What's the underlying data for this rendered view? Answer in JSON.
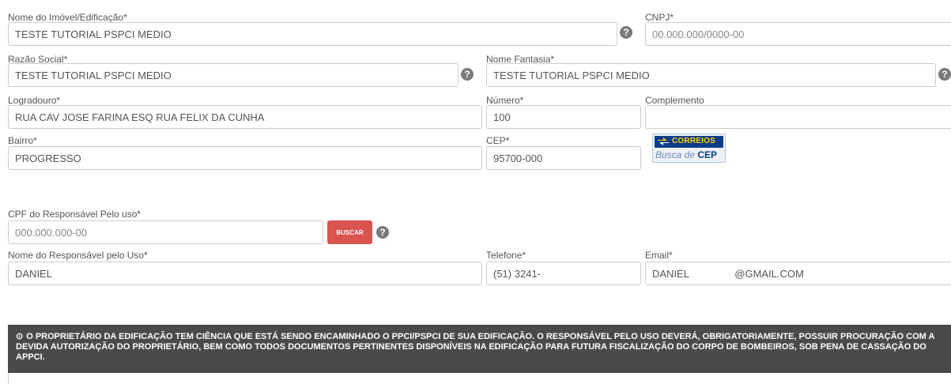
{
  "fields": {
    "nome_imovel": {
      "label": "Nome do Imóvel/Edificação*",
      "value": "TESTE TUTORIAL PSPCI MEDIO"
    },
    "cnpj": {
      "label": "CNPJ*",
      "placeholder": "00.000.000/0000-00"
    },
    "razao_social": {
      "label": "Razão Social*",
      "value": "TESTE TUTORIAL PSPCI MEDIO"
    },
    "nome_fantasia": {
      "label": "Nome Fantasia*",
      "value": "TESTE TUTORIAL PSPCI MEDIO"
    },
    "logradouro": {
      "label": "Logradouro*",
      "value": "RUA CAV JOSE FARINA ESQ RUA FELIX DA CUNHA"
    },
    "numero": {
      "label": "Número*",
      "value": "100"
    },
    "complemento": {
      "label": "Complemento",
      "value": ""
    },
    "bairro": {
      "label": "Bairro*",
      "value": "PROGRESSO"
    },
    "cep": {
      "label": "CEP*",
      "value": "95700-000"
    },
    "cpf_responsavel": {
      "label": "CPF do Responsável Pelo uso*",
      "placeholder": "000.000.000-00"
    },
    "nome_responsavel": {
      "label": "Nome do Responsável pelo Uso*",
      "value": "DANIEL"
    },
    "telefone": {
      "label": "Telefone*",
      "value": "(51) 3241-"
    },
    "email": {
      "label": "Email*",
      "value": "DANIEL                @GMAIL.COM"
    }
  },
  "help_icon_glyph": "?",
  "buttons": {
    "buscar": "BUSCAR"
  },
  "correios": {
    "name": "CORREIOS",
    "busca": "Busca de ",
    "cep": "CEP"
  },
  "notice": {
    "bullet": "⊙",
    "text": "O PROPRIETÁRIO DA EDIFICAÇÃO TEM CIÊNCIA QUE ESTÁ SENDO ENCAMINHADO O PPCI/PSPCI DE SUA EDIFICAÇÃO. O RESPONSÁVEL PELO USO DEVERÁ, OBRIGATORIAMENTE, POSSUIR PROCURAÇÃO COM A DEVIDA AUTORIZAÇÃO DO PROPRIETÁRIO, BEM COMO TODOS DOCUMENTOS PERTINENTES DISPONÍVEIS NA EDIFICAÇÃO PARA FUTURA FISCALIZAÇÃO DO CORPO DE BOMBEIROS, SOB PENA DE CASSAÇÃO DO APPCI."
  },
  "colors": {
    "buscar_button": "#d9534f",
    "notice_background": "#4a4a4a",
    "help_icon": "#7a7a7a",
    "correios_blue": "#0c3d8c",
    "correios_yellow": "#ffd200"
  }
}
